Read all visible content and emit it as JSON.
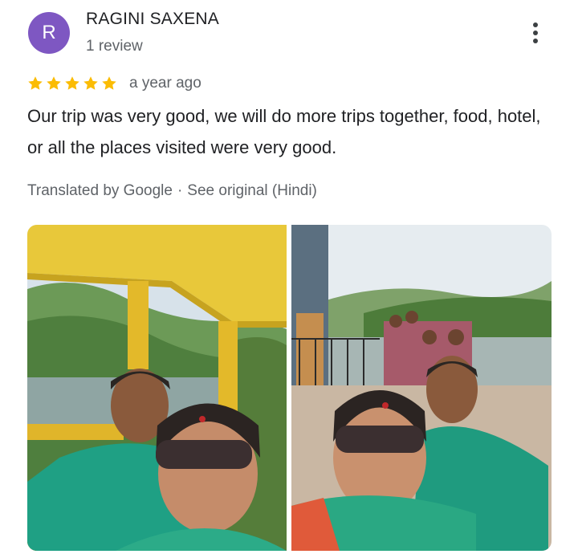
{
  "reviewer": {
    "initial": "R",
    "name": "RAGINI SAXENA",
    "review_count": "1 review",
    "avatar_color": "#7e57c2"
  },
  "review": {
    "rating": 5,
    "max_rating": 5,
    "star_color": "#fbbc04",
    "date": "a year ago",
    "text": "Our trip was very good, we will do more trips together, food, hotel, or all the places visited were very good.",
    "translated_by": "Translated by Google",
    "separator": "·",
    "see_original": "See original (Hindi)"
  },
  "menu": {
    "icon": "more-vert-icon"
  },
  "photos": [
    {
      "name": "review-photo-1"
    },
    {
      "name": "review-photo-2"
    }
  ]
}
